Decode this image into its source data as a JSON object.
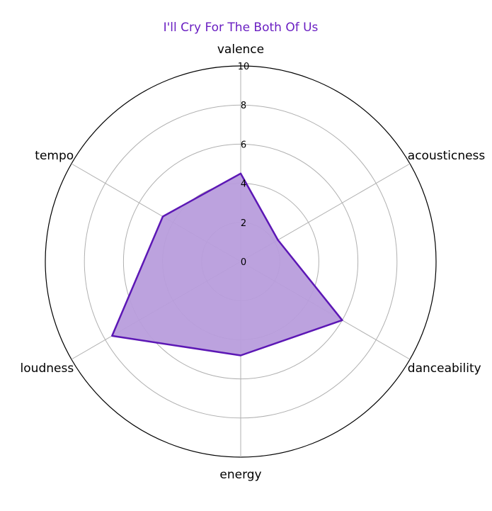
{
  "chart_data": {
    "type": "radar",
    "title": "I'll Cry For The Both Of Us",
    "categories": [
      "valence",
      "acousticness",
      "danceability",
      "energy",
      "loudness",
      "tempo"
    ],
    "series": [
      {
        "values": [
          4.5,
          2.2,
          6.0,
          4.8,
          7.6,
          4.6
        ]
      }
    ],
    "rlim": [
      0,
      10
    ],
    "rticks": [
      "0",
      "2",
      "4",
      "6",
      "8",
      "10"
    ],
    "grid": true,
    "colors": {
      "title": "#6a1fc2",
      "line": "#5c17b5",
      "fill": "#b89ddc",
      "grid": "#b0b0b0",
      "outline": "#000000"
    }
  }
}
